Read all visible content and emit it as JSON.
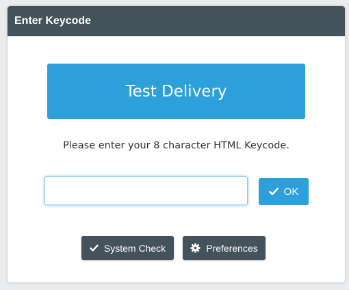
{
  "dialog": {
    "title": "Enter Keycode"
  },
  "banner": {
    "label": "Test Delivery"
  },
  "instructions": "Please enter your 8 character HTML Keycode.",
  "keycode_input": {
    "value": "",
    "placeholder": ""
  },
  "ok_button": {
    "label": "OK",
    "icon": "check-icon"
  },
  "footer": {
    "system_check_label": "System Check",
    "system_check_icon": "check-icon",
    "preferences_label": "Preferences",
    "preferences_icon": "gear-icon"
  },
  "colors": {
    "header_bg": "#44525c",
    "accent": "#2d9fda",
    "dark_button": "#44525c"
  }
}
